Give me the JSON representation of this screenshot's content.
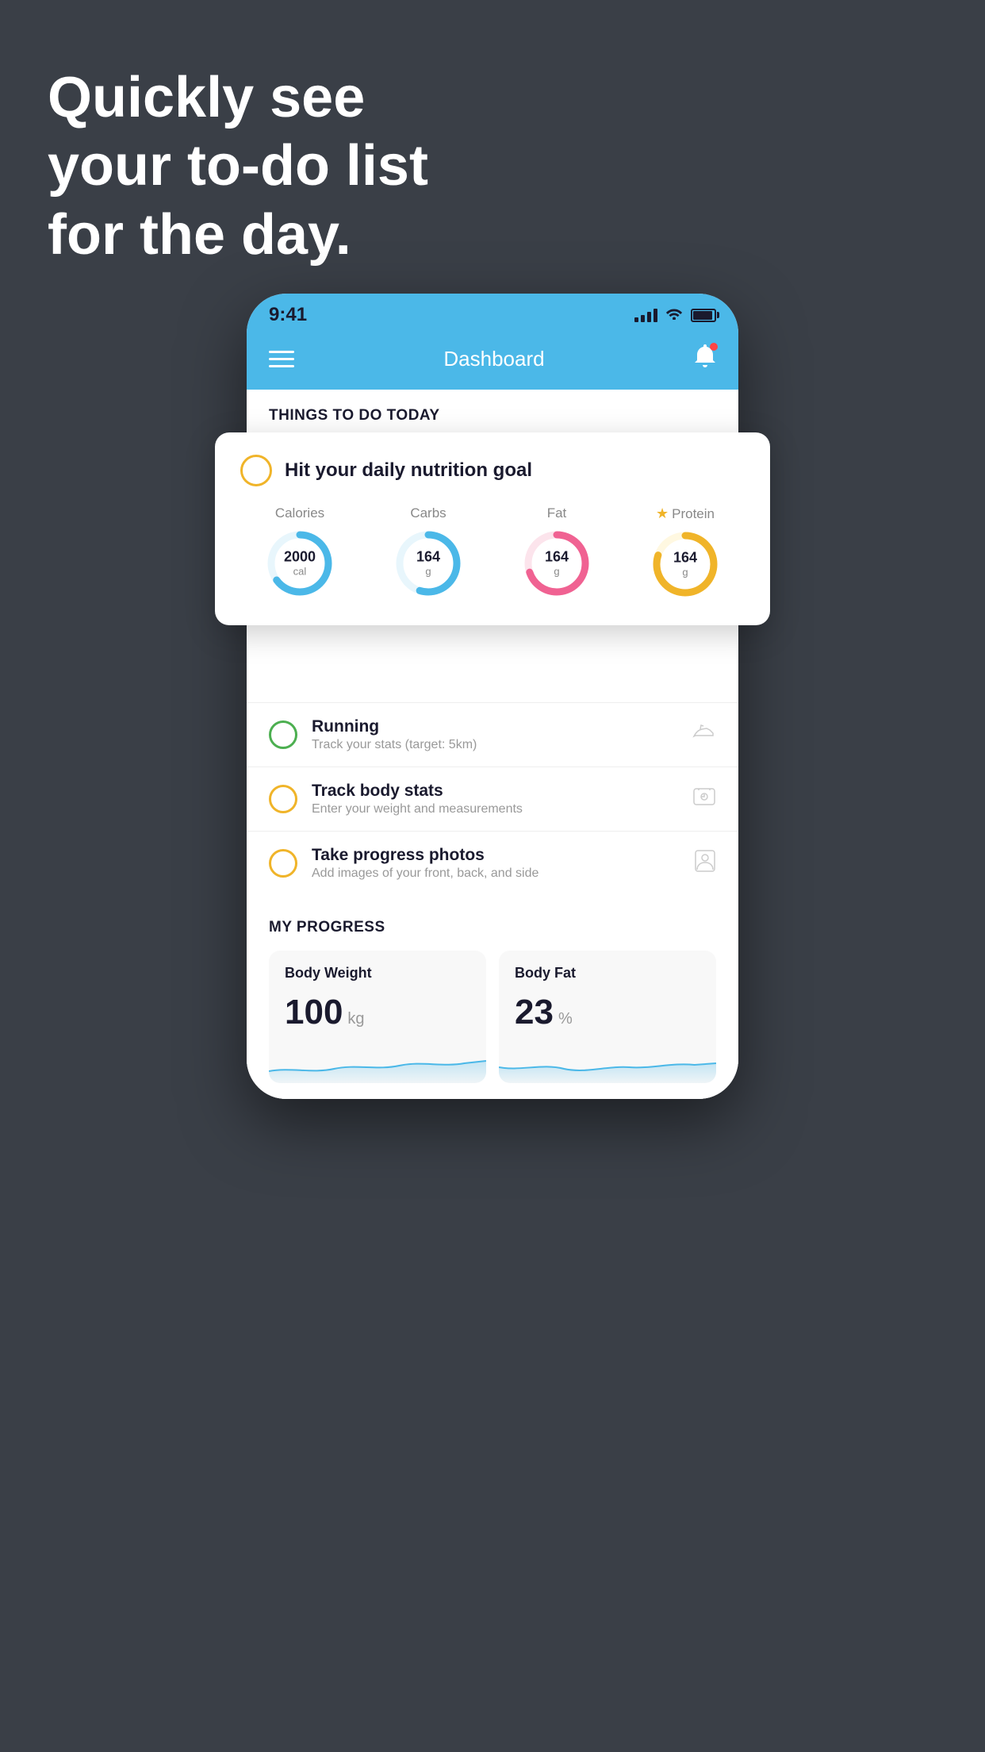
{
  "hero": {
    "line1": "Quickly see",
    "line2": "your to-do list",
    "line3": "for the day."
  },
  "statusBar": {
    "time": "9:41",
    "signalBars": [
      5,
      9,
      13,
      17
    ],
    "wifiSymbol": "wifi"
  },
  "header": {
    "title": "Dashboard"
  },
  "thingsToday": {
    "sectionLabel": "THINGS TO DO TODAY"
  },
  "nutritionCard": {
    "title": "Hit your daily nutrition goal",
    "items": [
      {
        "label": "Calories",
        "value": "2000",
        "unit": "cal",
        "color": "#4bb8e8",
        "trackColor": "#e8f6fc",
        "percentage": 65,
        "starred": false
      },
      {
        "label": "Carbs",
        "value": "164",
        "unit": "g",
        "color": "#4bb8e8",
        "trackColor": "#e8f6fc",
        "percentage": 55,
        "starred": false
      },
      {
        "label": "Fat",
        "value": "164",
        "unit": "g",
        "color": "#f06292",
        "trackColor": "#fce4ec",
        "percentage": 70,
        "starred": false
      },
      {
        "label": "Protein",
        "value": "164",
        "unit": "g",
        "color": "#f0b429",
        "trackColor": "#fff8e1",
        "percentage": 80,
        "starred": true
      }
    ]
  },
  "todoItems": [
    {
      "id": "running",
      "title": "Running",
      "subtitle": "Track your stats (target: 5km)",
      "circleColor": "green",
      "iconType": "shoe"
    },
    {
      "id": "body-stats",
      "title": "Track body stats",
      "subtitle": "Enter your weight and measurements",
      "circleColor": "yellow",
      "iconType": "scale"
    },
    {
      "id": "progress-photos",
      "title": "Take progress photos",
      "subtitle": "Add images of your front, back, and side",
      "circleColor": "yellow",
      "iconType": "portrait"
    }
  ],
  "progressSection": {
    "sectionLabel": "MY PROGRESS",
    "cards": [
      {
        "title": "Body Weight",
        "value": "100",
        "unit": "kg"
      },
      {
        "title": "Body Fat",
        "value": "23",
        "unit": "%"
      }
    ]
  }
}
